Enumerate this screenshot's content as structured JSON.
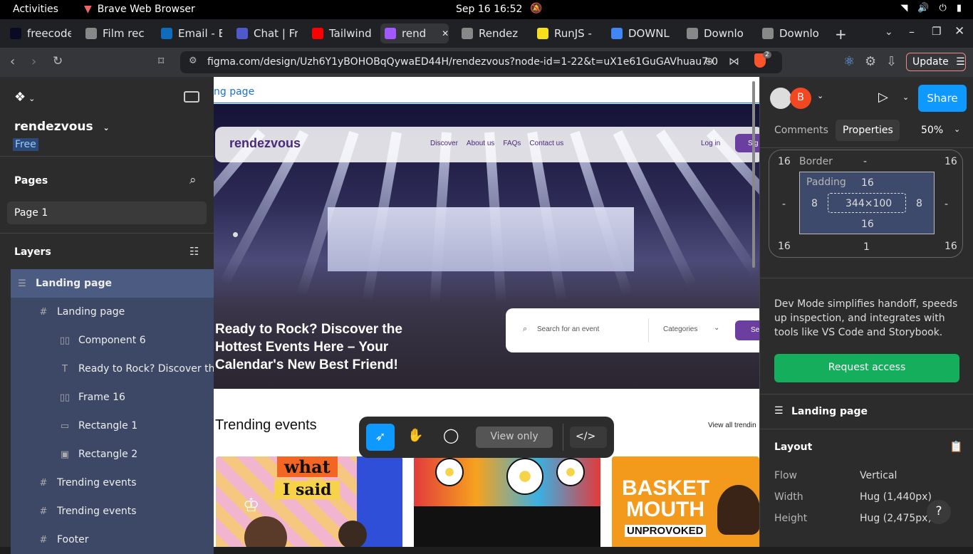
{
  "os": {
    "activities": "Activities",
    "app_name": "Brave Web Browser",
    "clock": "Sep 16  16:52"
  },
  "tabs": [
    {
      "label": "freecode",
      "color": "#0a0a23"
    },
    {
      "label": "Film rec",
      "color": "#888888"
    },
    {
      "label": "Email - E",
      "color": "#0f6cbd"
    },
    {
      "label": "Chat | Fr",
      "color": "#5059c9"
    },
    {
      "label": "Tailwind",
      "color": "#ff0000"
    },
    {
      "label": "rend",
      "color": "#a259ff"
    },
    {
      "label": "Rendez",
      "color": "#888888"
    },
    {
      "label": "RunJS -",
      "color": "#f7df1e"
    },
    {
      "label": "DOWNL",
      "color": "#4285f4"
    },
    {
      "label": "Downlo",
      "color": "#888888"
    },
    {
      "label": "Downlo",
      "color": "#888888"
    }
  ],
  "address_bar": {
    "url": "figma.com/design/Uzh6Y1yBOHOBqQywaED44H/rendezvous?node-id=1-22&t=uX1e61GuGAVhuau7-0",
    "update_label": "Update",
    "shield_count": "2"
  },
  "left_panel": {
    "file_name": "rendezvous",
    "plan_badge": "Free",
    "pages_heading": "Pages",
    "page_item": "Page 1",
    "layers_heading": "Layers",
    "layers": [
      {
        "label": "Landing page",
        "icon": "auto-layout-icon",
        "glyph": "☰"
      },
      {
        "label": "Landing page",
        "icon": "frame-icon",
        "glyph": "#"
      },
      {
        "label": "Component 6",
        "icon": "auto-layout-horizontal-icon",
        "glyph": "▯▯"
      },
      {
        "label": "Ready to Rock? Discover the",
        "icon": "text-icon",
        "glyph": "T"
      },
      {
        "label": "Frame 16",
        "icon": "auto-layout-horizontal-icon",
        "glyph": "▯▯"
      },
      {
        "label": "Rectangle 1",
        "icon": "rectangle-icon",
        "glyph": "▭"
      },
      {
        "label": "Rectangle 2",
        "icon": "image-icon",
        "glyph": "▣"
      },
      {
        "label": "Trending events",
        "icon": "frame-icon",
        "glyph": "#"
      },
      {
        "label": "Trending events",
        "icon": "frame-icon",
        "glyph": "#"
      },
      {
        "label": "Footer",
        "icon": "frame-icon",
        "glyph": "#"
      }
    ]
  },
  "canvas": {
    "frame_label": "ng page",
    "brand": "rendezvous",
    "nav_links": [
      "Discover",
      "About us",
      "FAQs",
      "Contact us"
    ],
    "login": "Log in",
    "signup": "Sig",
    "hero_text": "Ready to Rock? Discover the Hottest Events Here – Your Calendar's New Best Friend!",
    "search_placeholder": "Search for an event",
    "categories": "Categories",
    "search_btn": "Se",
    "trending_title": "Trending events",
    "view_all": "View all trendin",
    "card1_words": [
      "what",
      "I said"
    ],
    "card3_words": [
      "BASKET",
      "MOUTH",
      "UNPROVOKED"
    ],
    "toolbar_view_only": "View only"
  },
  "right_panel": {
    "avatar_letter": "B",
    "share_label": "Share",
    "tab_comments": "Comments",
    "tab_properties": "Properties",
    "zoom": "50%",
    "box_model": {
      "margin_top_left": "16",
      "border_label": "Border",
      "border_value": "-",
      "margin_top_right": "16",
      "side_left": "-",
      "side_right": "-",
      "padding_label": "Padding",
      "padding_top": "16",
      "padding_left": "8",
      "padding_right": "8",
      "padding_bottom": "16",
      "content_size": "344×100",
      "margin_bottom_left": "16",
      "margin_bottom": "1",
      "margin_bottom_right": "16"
    },
    "dev_mode_text": "Dev Mode simplifies handoff, speeds up inspection, and integrates with tools like VS Code and Storybook.",
    "request_access": "Request access",
    "selection_name": "Landing page",
    "layout_heading": "Layout",
    "layout_rows": [
      {
        "label": "Flow",
        "value": "Vertical"
      },
      {
        "label": "Width",
        "value": "Hug (1,440px)"
      },
      {
        "label": "Height",
        "value": "Hug (2,475px)"
      }
    ],
    "help": "?"
  },
  "colors": {
    "accent_blue": "#0d99ff",
    "request_green": "#14ae5c",
    "brand_purple": "#6b3fa0",
    "avatar_red": "#f24822"
  }
}
